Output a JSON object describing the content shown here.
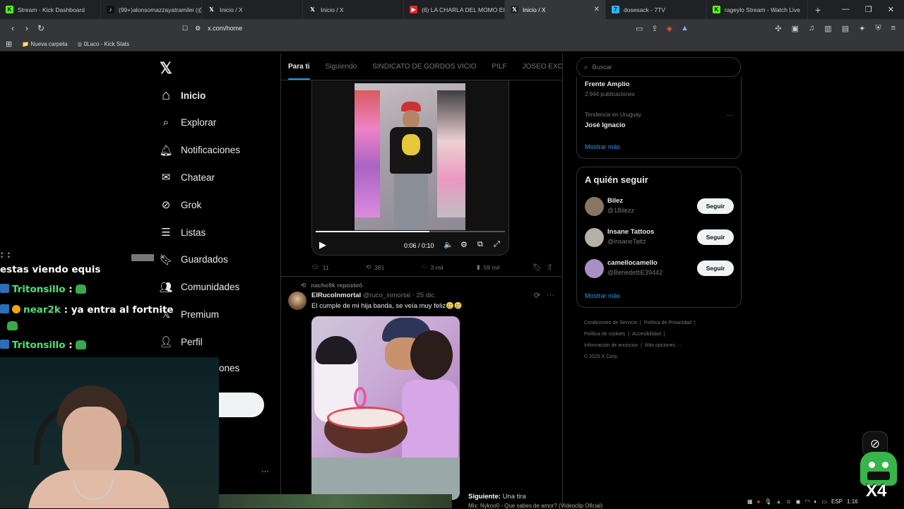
{
  "browser": {
    "tabs": [
      {
        "title": "Stream - Kick Dashboard",
        "favicon": "kick-icon"
      },
      {
        "title": "(99+)alonsomazzayatramilei (@",
        "favicon": "tiktok-icon"
      },
      {
        "title": "Inicio / X",
        "favicon": "x-icon"
      },
      {
        "title": "Inicio / X",
        "favicon": "x-icon"
      },
      {
        "title": "(6) LA CHARLA DEL MOMO EN",
        "favicon": "youtube-icon"
      },
      {
        "title": "Inicio / X",
        "favicon": "x-icon",
        "active": true
      },
      {
        "title": "dosesack - 7TV",
        "favicon": "7tv-icon"
      },
      {
        "title": "rageylo Stream - Watch Live",
        "favicon": "kick-icon"
      }
    ],
    "url": "x.com/home",
    "bookmarks": [
      "Nueva carpeta",
      "0Laco - Kick Stats"
    ]
  },
  "nav": {
    "items": [
      {
        "label": "Inicio",
        "icon": "home-icon"
      },
      {
        "label": "Explorar",
        "icon": "search-icon"
      },
      {
        "label": "Notificaciones",
        "icon": "bell-icon"
      },
      {
        "label": "Chatear",
        "icon": "mail-icon"
      },
      {
        "label": "Grok",
        "icon": "grok-icon"
      },
      {
        "label": "Listas",
        "icon": "list-icon"
      },
      {
        "label": "Guardados",
        "icon": "bookmark-icon"
      },
      {
        "label": "Comunidades",
        "icon": "communities-icon"
      },
      {
        "label": "Premium",
        "icon": "x-premium-icon"
      },
      {
        "label": "Perfil",
        "icon": "user-icon"
      },
      {
        "label": "ones",
        "icon": "more-icon"
      }
    ],
    "post_button": "r"
  },
  "feed": {
    "tabs": [
      "Para ti",
      "Siguiendo",
      "SINDICATO DE GORDOS VICIO",
      "PILF",
      "JOSEO EXCLUSI"
    ],
    "video": {
      "time": "0:06 / 0:10",
      "progress": 0.6
    },
    "post1_stats": {
      "replies": "11",
      "reposts": "381",
      "likes": "3 mil",
      "views": "59 mil"
    },
    "post2": {
      "reposted_by": "nacho9k reposteó",
      "name": "ElRucoInmortal",
      "handle": "@ruco_inmortal",
      "date": "· 25 dic.",
      "text": "El cumple de mi hija banda, se veía muy feliz🥲🥲"
    }
  },
  "sidebar": {
    "search_placeholder": "Buscar",
    "trend_partial": {
      "name": "Frente Amplio",
      "count": "2.944 publicaciones"
    },
    "trend": {
      "context": "Tendencia en Uruguay",
      "name": "José Ignacio"
    },
    "show_more": "Mostrar más",
    "follow_title": "A quién seguir",
    "follow": [
      {
        "name": "Bilez",
        "handle": "@1Bilezz",
        "button": "Seguir",
        "color": "#8a7560"
      },
      {
        "name": "Insane Tattoos",
        "handle": "@insaneTattz",
        "button": "Seguir",
        "color": "#b5b0a8"
      },
      {
        "name": "camellocamello",
        "handle": "@BenedettiE39442",
        "button": "Seguir",
        "color": "#a88fc4"
      }
    ],
    "footer": [
      "Condiciones de Servicio",
      "Política de Privacidad",
      "Política de cookies",
      "Accesibilidad",
      "Información de anuncios",
      "Más opciones ···",
      "© 2025 X Corp."
    ]
  },
  "stream_overlay": {
    "chat": [
      {
        "user": "",
        "text": "estas viendo equis"
      },
      {
        "user": "Tritonsillo",
        "text": ""
      },
      {
        "user": "near2k",
        "text": "ya entra al fortnite"
      },
      {
        "user": "Tritonsillo",
        "text": ""
      }
    ],
    "now_playing": {
      "label": "Siguiente:",
      "value": "Una tira"
    },
    "music_line": "Mix: Nykoo0 - Que sabes de amor? (Videoclip Oficial)",
    "emote_text": "X4",
    "taskbar_lang": "ESP",
    "taskbar_time": "1:16"
  },
  "colors": {
    "accent": "#1d9bf0",
    "chat_green": "#4be27a"
  }
}
